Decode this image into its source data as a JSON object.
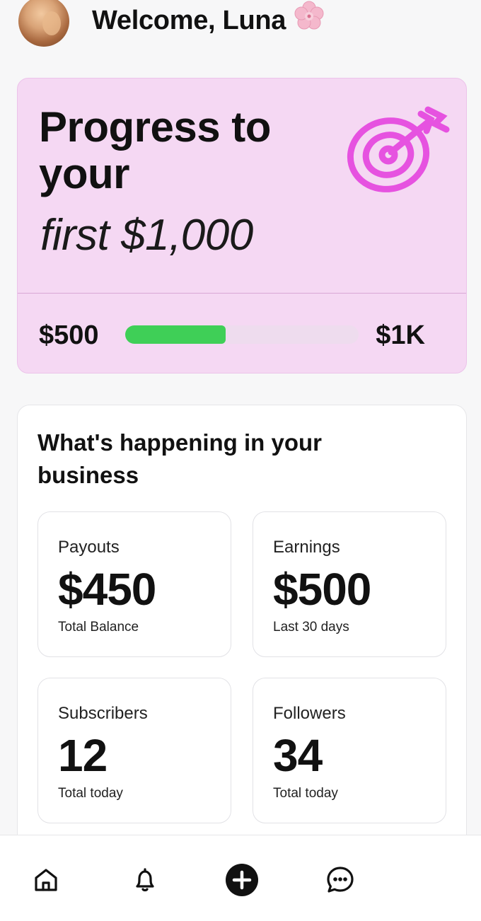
{
  "header": {
    "welcome": "Welcome, Luna"
  },
  "progress_card": {
    "title": "Progress to your",
    "goal": "first $1,000",
    "start_label": "$500",
    "end_label": "$1K",
    "progress_fraction": 0.43,
    "fill_color": "#3fcf57",
    "card_color": "#f5d8f3",
    "icon": "target-icon"
  },
  "business": {
    "title": "What's happening in your business",
    "stats": [
      {
        "label": "Payouts",
        "value": "$450",
        "sub": "Total Balance"
      },
      {
        "label": "Earnings",
        "value": "$500",
        "sub": "Last 30 days"
      },
      {
        "label": "Subscribers",
        "value": "12",
        "sub": "Total today"
      },
      {
        "label": "Followers",
        "value": "34",
        "sub": "Total today"
      }
    ]
  },
  "nav": {
    "items": [
      "home-icon",
      "bell-icon",
      "plus-circle-icon",
      "chat-icon"
    ]
  }
}
